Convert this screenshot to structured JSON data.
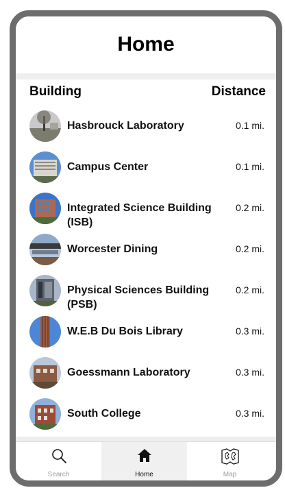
{
  "header": {
    "title": "Home"
  },
  "columns": {
    "building": "Building",
    "distance": "Distance"
  },
  "buildings": [
    {
      "name": "Hasbrouck Laboratory",
      "distance": "0.1 mi."
    },
    {
      "name": "Campus Center",
      "distance": "0.1 mi."
    },
    {
      "name": "Integrated Science Building (ISB)",
      "distance": "0.2 mi."
    },
    {
      "name": "Worcester Dining",
      "distance": "0.2 mi."
    },
    {
      "name": "Physical Sciences Building (PSB)",
      "distance": "0.2 mi."
    },
    {
      "name": "W.E.B Du Bois Library",
      "distance": "0.3 mi."
    },
    {
      "name": "Goessmann Laboratory",
      "distance": "0.3 mi."
    },
    {
      "name": "South College",
      "distance": "0.3 mi."
    }
  ],
  "tabs": [
    {
      "label": "Search",
      "icon": "search-icon",
      "active": false,
      "color": "#9a9a9a"
    },
    {
      "label": "Home",
      "icon": "home-icon",
      "active": true,
      "color": "#111111"
    },
    {
      "label": "Map",
      "icon": "map-icon",
      "active": false,
      "color": "#9a9a9a"
    }
  ],
  "colors": {
    "frame": "#6d6d6d",
    "separator": "#eeeeee",
    "active_tab": "#f0f0f0"
  }
}
